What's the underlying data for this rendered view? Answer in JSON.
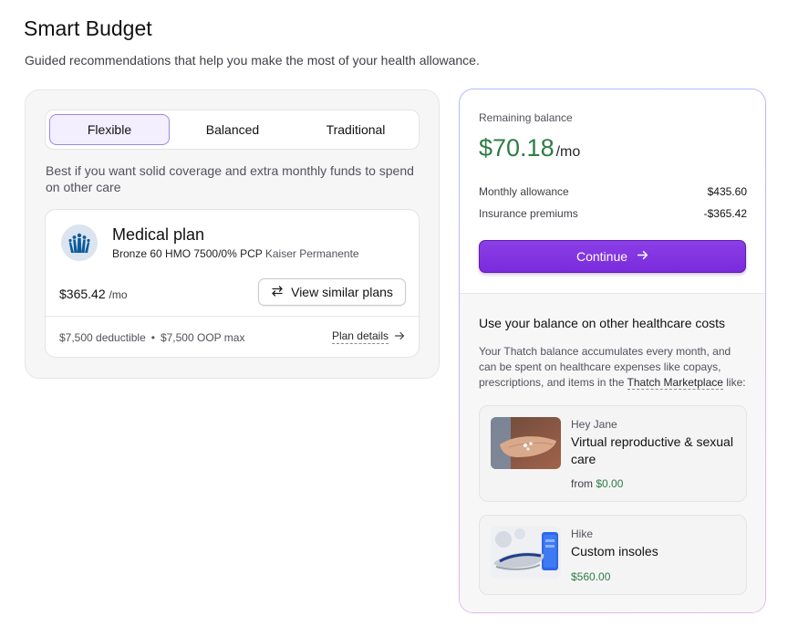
{
  "header": {
    "title": "Smart Budget",
    "subtitle": "Guided recommendations that help you make the most of your health allowance."
  },
  "plan_modes": {
    "tabs": [
      {
        "label": "Flexible",
        "active": true
      },
      {
        "label": "Balanced",
        "active": false
      },
      {
        "label": "Traditional",
        "active": false
      }
    ],
    "description": "Best if you want solid coverage and extra monthly funds to spend on other care"
  },
  "plan": {
    "name": "Medical plan",
    "details": "Bronze 60 HMO 7500/0% PCP",
    "carrier": "Kaiser Permanente",
    "price": "$365.42",
    "price_unit": "/mo",
    "similar_label": "View similar plans",
    "deductible": "$7,500 deductible",
    "oop_max": "$7,500 OOP max",
    "details_link": "Plan details"
  },
  "balance": {
    "label": "Remaining balance",
    "amount": "$70.18",
    "unit": "/mo",
    "amount_color": "#2e7d46",
    "rows": [
      {
        "label": "Monthly allowance",
        "value": "$435.60"
      },
      {
        "label": "Insurance premiums",
        "value": "-$365.42"
      }
    ],
    "continue_label": "Continue",
    "accent": "#7a2bdc"
  },
  "other_costs": {
    "title": "Use your balance on other healthcare costs",
    "desc_before": "Your Thatch balance accumulates every month, and can be spent on healthcare expenses like copays, prescriptions, and items in the ",
    "link": "Thatch Marketplace",
    "desc_after": " like:",
    "offers": [
      {
        "brand": "Hey Jane",
        "title": "Virtual reproductive & sexual care",
        "price_prefix": "from ",
        "price": "$0.00"
      },
      {
        "brand": "Hike",
        "title": "Custom insoles",
        "price_prefix": "",
        "price": "$560.00"
      }
    ]
  }
}
